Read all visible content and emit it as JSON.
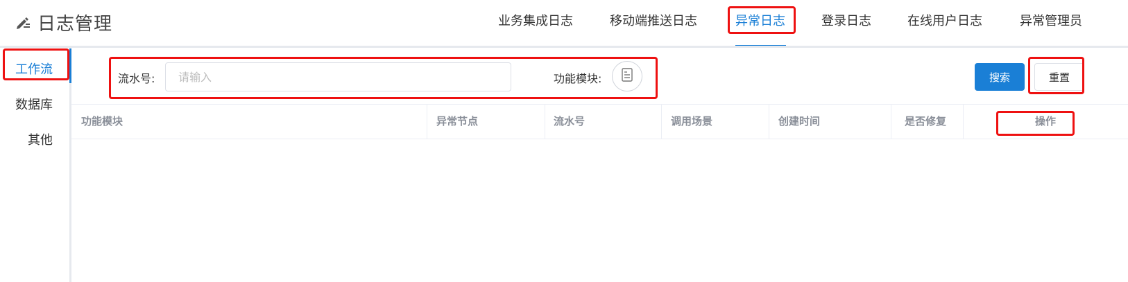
{
  "header": {
    "title": "日志管理",
    "brand_icon": "edit-icon",
    "nav_tabs": [
      {
        "label": "业务集成日志",
        "active": false
      },
      {
        "label": "移动端推送日志",
        "active": false
      },
      {
        "label": "异常日志",
        "active": true
      },
      {
        "label": "登录日志",
        "active": false
      },
      {
        "label": "在线用户日志",
        "active": false
      },
      {
        "label": "异常管理员",
        "active": false
      }
    ]
  },
  "sidebar": {
    "items": [
      {
        "label": "工作流",
        "active": true
      },
      {
        "label": "数据库",
        "active": false
      },
      {
        "label": "其他",
        "active": false
      }
    ]
  },
  "search": {
    "serial_label": "流水号:",
    "serial_placeholder": "请输入",
    "serial_value": "",
    "module_label": "功能模块:",
    "module_icon": "document-icon",
    "search_button": "搜索",
    "reset_button": "重置"
  },
  "table": {
    "columns": [
      "功能模块",
      "异常节点",
      "流水号",
      "调用场景",
      "创建时间",
      "是否修复",
      "操作"
    ],
    "rows": []
  },
  "colors": {
    "accent": "#1a7fd6",
    "highlight": "#ee1111"
  }
}
